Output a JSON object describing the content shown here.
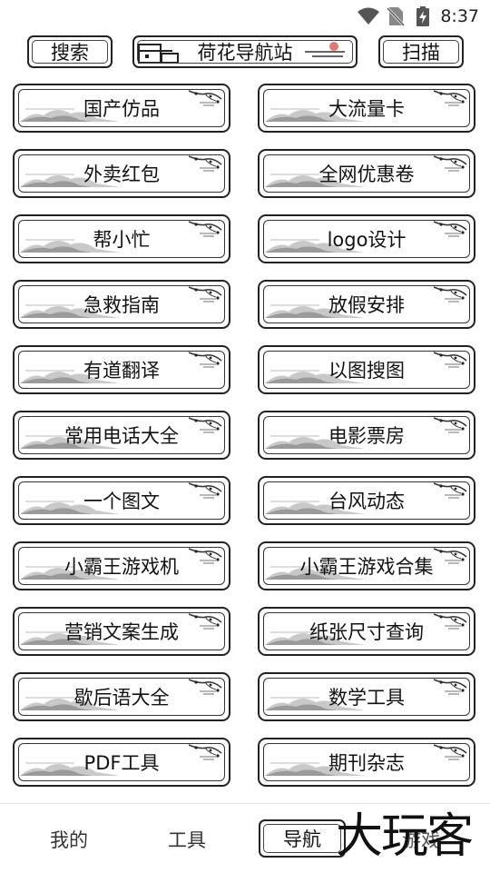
{
  "status_bar": {
    "time": "8:37",
    "icons": [
      "wifi-icon",
      "no-sim-icon",
      "battery-charging-icon"
    ]
  },
  "header": {
    "search_label": "搜索",
    "title": "荷花导航站",
    "scan_label": "扫描"
  },
  "items": [
    "国产仿品",
    "大流量卡",
    "外卖红包",
    "全网优惠卷",
    "帮小忙",
    "logo设计",
    "急救指南",
    "放假安排",
    "有道翻译",
    "以图搜图",
    "常用电话大全",
    "电影票房",
    "一个图文",
    "台风动态",
    "小霸王游戏机",
    "小霸王游戏合集",
    "营销文案生成",
    "纸张尺寸查询",
    "歇后语大全",
    "数学工具",
    "PDF工具",
    "期刊杂志"
  ],
  "bottom_nav": {
    "mine": "我的",
    "tools": "工具",
    "nav": "导航",
    "games": "游戏",
    "active": "nav"
  },
  "watermark": "大玩客"
}
